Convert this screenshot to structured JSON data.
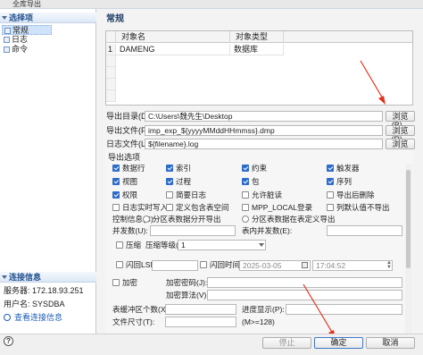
{
  "window": {
    "title": "全库导出"
  },
  "sidebar": {
    "select_header": "选择项",
    "items": [
      {
        "label": "常规",
        "selected": true
      },
      {
        "label": "日志",
        "selected": false
      },
      {
        "label": "命令",
        "selected": false
      }
    ],
    "connection_header": "连接信息",
    "server": "服务器: 172.18.93.251",
    "user": "用户名: SYSDBA",
    "view_link": "查看连接信息"
  },
  "main": {
    "section_title": "常规",
    "grid": {
      "columns": [
        "对象名",
        "对象类型"
      ],
      "rows": [
        {
          "num": "1",
          "name": "DAMENG",
          "type": "数据库"
        }
      ]
    },
    "export_dir": {
      "label": "导出目录(D):",
      "value": "C:\\Users\\魏先生\\Desktop",
      "browse": "浏览(B)..."
    },
    "export_file": {
      "label": "导出文件(F):",
      "value": "imp_exp_${yyyyMMddHHmmss}.dmp",
      "browse": "浏览(R)..."
    },
    "log_file": {
      "label": "日志文件(L):",
      "value": "${filename}.log",
      "browse": "浏览(W)..."
    },
    "options": {
      "title": "导出选项",
      "checkboxes": [
        {
          "label": "数据行",
          "checked": true
        },
        {
          "label": "索引",
          "checked": true
        },
        {
          "label": "约束",
          "checked": true
        },
        {
          "label": "触发器",
          "checked": true
        },
        {
          "label": "视图",
          "checked": true
        },
        {
          "label": "过程",
          "checked": true
        },
        {
          "label": "包",
          "checked": true
        },
        {
          "label": "序列",
          "checked": true
        },
        {
          "label": "权限",
          "checked": true
        },
        {
          "label": "简要日志",
          "checked": false
        },
        {
          "label": "允许脏读",
          "checked": false
        },
        {
          "label": "导出后删除",
          "checked": false
        },
        {
          "label": "日志实时写入",
          "checked": false
        },
        {
          "label": "定义包含表空间",
          "checked": false
        },
        {
          "label": "MPP_LOCAL登录",
          "checked": false
        },
        {
          "label": "列默认值不导出",
          "checked": false
        }
      ],
      "control_info_label": "控制信息(C):",
      "radios": [
        "分区表数据分开导出",
        "分区表数据在表定义导出"
      ],
      "parallel_label": "并发数(U):",
      "table_parallel_label": "表内并发数(E):",
      "compress_label": "压缩",
      "compress_level_label": "压缩等级(L):",
      "compress_level_value": "1",
      "flashback_lsn_label": "闪回LSN:",
      "flashback_time_label": "闪回时间:",
      "flashback_date": "2025-03-05",
      "flashback_clock": "17:04:52",
      "encrypt_label": "加密",
      "encrypt_pwd_label": "加密密码(J):",
      "encrypt_alg_label": "加密算法(V):",
      "buffer_label": "表缓冲区个数(X):",
      "progress_label": "进度显示(P):",
      "file_size_label": "文件尺寸(T):",
      "file_size_value": "(M>=128)"
    }
  },
  "footer": {
    "help": "?",
    "stop": "停止",
    "ok": "确定",
    "cancel": "取消"
  },
  "colors": {
    "accent": "#2d6ccb",
    "arrow": "#e3311d"
  }
}
